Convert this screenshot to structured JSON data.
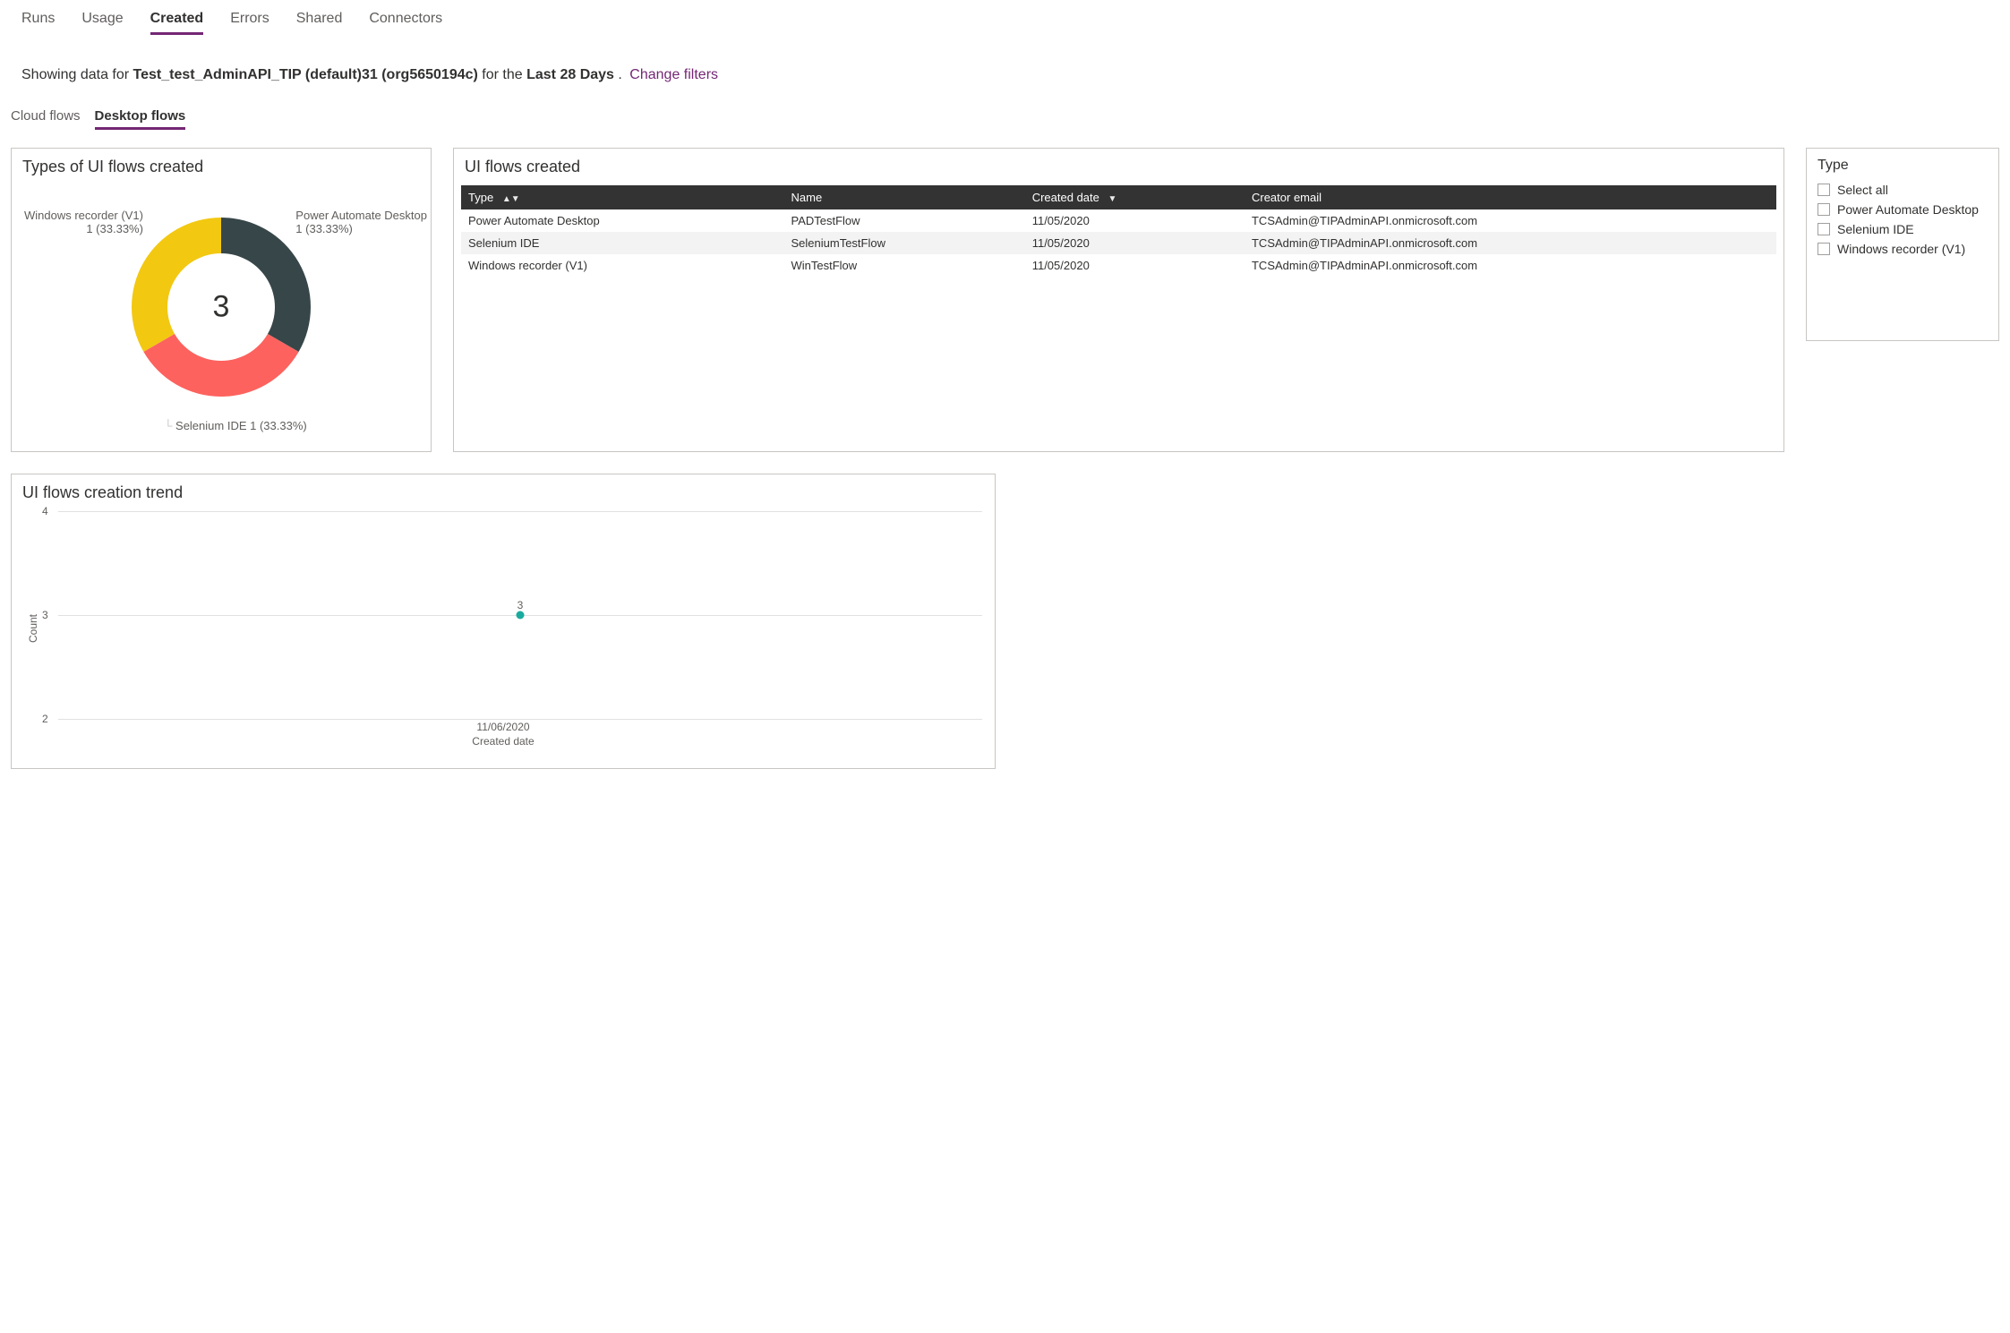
{
  "topTabs": {
    "runs": "Runs",
    "usage": "Usage",
    "created": "Created",
    "errors": "Errors",
    "shared": "Shared",
    "connectors": "Connectors"
  },
  "summary": {
    "prefix": "Showing data for ",
    "env": "Test_test_AdminAPI_TIP (default)31 (org5650194c)",
    "middle": " for the ",
    "period": "Last 28 Days",
    "suffix": ". ",
    "changeFilters": "Change filters"
  },
  "subTabs": {
    "cloud": "Cloud flows",
    "desktop": "Desktop flows"
  },
  "donut": {
    "title": "Types of UI flows created",
    "centerValue": "3",
    "labels": {
      "windows": "Windows recorder (V1)",
      "windowsSub": "1 (33.33%)",
      "pad": "Power Automate Desktop",
      "padSub": "1 (33.33%)",
      "selenium": "Selenium IDE 1 (33.33%)"
    }
  },
  "table": {
    "title": "UI flows created",
    "headers": {
      "type": "Type",
      "name": "Name",
      "created": "Created date",
      "email": "Creator email"
    },
    "rows": [
      {
        "type": "Power Automate Desktop",
        "name": "PADTestFlow",
        "date": "11/05/2020",
        "email": "TCSAdmin@TIPAdminAPI.onmicrosoft.com"
      },
      {
        "type": "Selenium IDE",
        "name": "SeleniumTestFlow",
        "date": "11/05/2020",
        "email": "TCSAdmin@TIPAdminAPI.onmicrosoft.com"
      },
      {
        "type": "Windows recorder (V1)",
        "name": "WinTestFlow",
        "date": "11/05/2020",
        "email": "TCSAdmin@TIPAdminAPI.onmicrosoft.com"
      }
    ]
  },
  "filter": {
    "title": "Type",
    "options": {
      "all": "Select all",
      "pad": "Power Automate Desktop",
      "selenium": "Selenium IDE",
      "windows": "Windows recorder (V1)"
    }
  },
  "trend": {
    "title": "UI flows creation trend",
    "ylabel": "Count",
    "xlabel": "Created date",
    "yticks": {
      "t4": "4",
      "t3": "3",
      "t2": "2"
    },
    "pointValue": "3",
    "xtick": "11/06/2020"
  },
  "chart_data": [
    {
      "type": "pie",
      "title": "Types of UI flows created",
      "categories": [
        "Windows recorder (V1)",
        "Power Automate Desktop",
        "Selenium IDE"
      ],
      "values": [
        1,
        1,
        1
      ],
      "percentages": [
        33.33,
        33.33,
        33.33
      ],
      "totalCenter": 3,
      "colors": [
        "#f2c811",
        "#374649",
        "#fd625e"
      ]
    },
    {
      "type": "scatter",
      "title": "UI flows creation trend",
      "xlabel": "Created date",
      "ylabel": "Count",
      "x": [
        "11/06/2020"
      ],
      "y": [
        3
      ],
      "ylim": [
        2,
        4
      ],
      "gridlines_y": [
        2,
        3,
        4
      ],
      "point_color": "#1aab9f"
    }
  ]
}
